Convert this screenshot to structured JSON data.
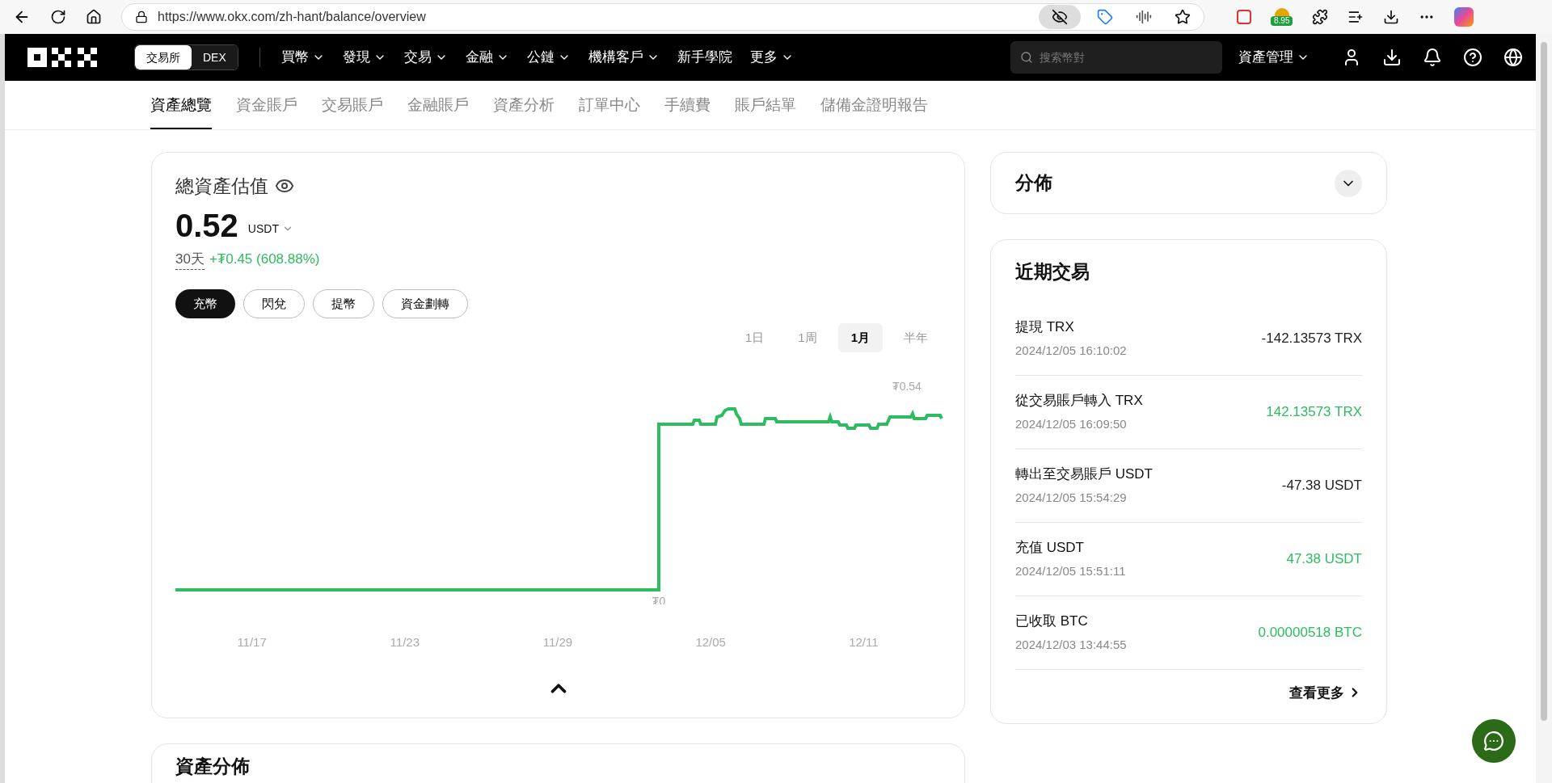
{
  "browser": {
    "url": "https://www.okx.com/zh-hant/balance/overview",
    "tracking_prevention_on": true,
    "extension_badge": "8.95"
  },
  "header": {
    "mode_tabs": [
      {
        "label": "交易所",
        "selected": true
      },
      {
        "label": "DEX",
        "selected": false
      }
    ],
    "nav": [
      {
        "label": "買幣",
        "has_menu": true
      },
      {
        "label": "發現",
        "has_menu": true
      },
      {
        "label": "交易",
        "has_menu": true
      },
      {
        "label": "金融",
        "has_menu": true
      },
      {
        "label": "公鏈",
        "has_menu": true
      },
      {
        "label": "機構客戶",
        "has_menu": true
      },
      {
        "label": "新手學院",
        "has_menu": false
      },
      {
        "label": "更多",
        "has_menu": true
      }
    ],
    "search": {
      "placeholder": "搜索幣對"
    },
    "asset_menu": "資產管理"
  },
  "subnav": [
    {
      "label": "資產總覽",
      "selected": true
    },
    {
      "label": "資金賬戶",
      "selected": false
    },
    {
      "label": "交易賬戶",
      "selected": false
    },
    {
      "label": "金融賬戶",
      "selected": false
    },
    {
      "label": "資產分析",
      "selected": false
    },
    {
      "label": "訂單中心",
      "selected": false
    },
    {
      "label": "手續費",
      "selected": false
    },
    {
      "label": "賬戶結單",
      "selected": false
    },
    {
      "label": "儲備金證明報告",
      "selected": false
    }
  ],
  "overview": {
    "title": "總資產估值",
    "amount": "0.52",
    "currency": "USDT",
    "period": "30天",
    "change": "+₮0.45 (608.88%)",
    "actions": [
      {
        "label": "充幣",
        "primary": true
      },
      {
        "label": "閃兌",
        "primary": false
      },
      {
        "label": "提幣",
        "primary": false
      },
      {
        "label": "資金劃轉",
        "primary": false
      }
    ],
    "ranges": [
      {
        "label": "1日",
        "selected": false
      },
      {
        "label": "1周",
        "selected": false
      },
      {
        "label": "1月",
        "selected": true
      },
      {
        "label": "半年",
        "selected": false
      }
    ],
    "chart": {
      "x_labels": [
        "11/17",
        "11/23",
        "11/29",
        "12/05",
        "12/11"
      ],
      "min_label": "₮0",
      "max_label": "₮0.54"
    }
  },
  "distribution": {
    "title": "分佈",
    "expanded": false
  },
  "recent": {
    "title": "近期交易",
    "items": [
      {
        "title": "提現 TRX",
        "time": "2024/12/05 16:10:02",
        "amount": "-142.13573 TRX",
        "kind": "debit"
      },
      {
        "title": "從交易賬戶轉入 TRX",
        "time": "2024/12/05 16:09:50",
        "amount": "142.13573 TRX",
        "kind": "credit"
      },
      {
        "title": "轉出至交易賬戶 USDT",
        "time": "2024/12/05 15:54:29",
        "amount": "-47.38 USDT",
        "kind": "debit"
      },
      {
        "title": "充值 USDT",
        "time": "2024/12/05 15:51:11",
        "amount": "47.38 USDT",
        "kind": "credit"
      },
      {
        "title": "已收取 BTC",
        "time": "2024/12/03 13:44:55",
        "amount": "0.00000518 BTC",
        "kind": "credit"
      }
    ],
    "more": "查看更多"
  },
  "asset_section": {
    "title": "資產分佈"
  }
}
